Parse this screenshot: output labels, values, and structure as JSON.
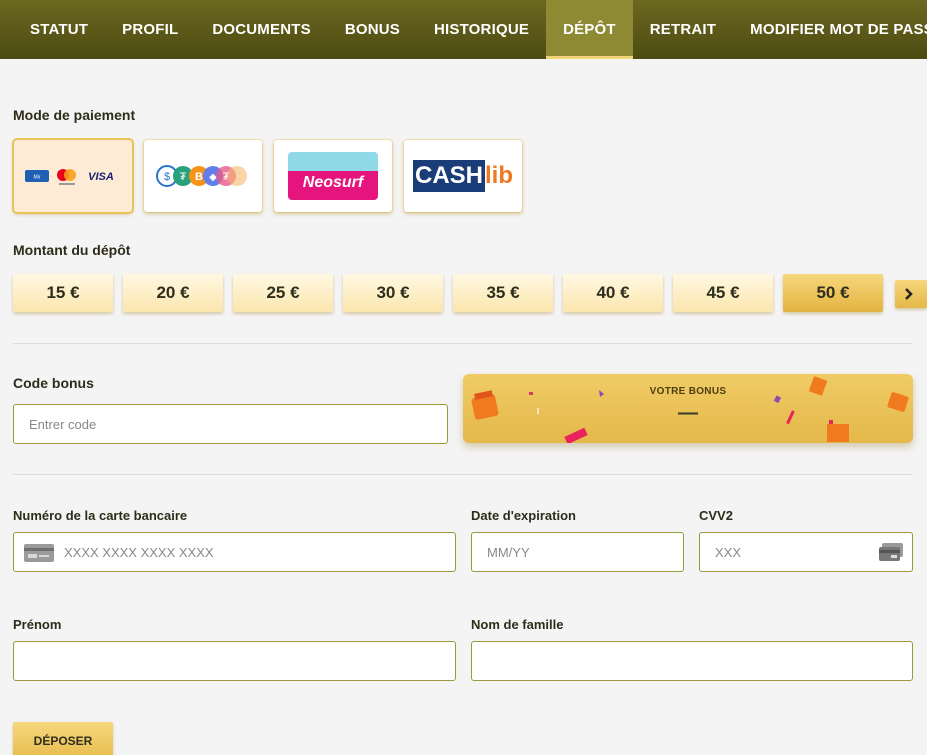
{
  "nav": {
    "items": [
      {
        "label": "STATUT",
        "active": false
      },
      {
        "label": "PROFIL",
        "active": false
      },
      {
        "label": "DOCUMENTS",
        "active": false
      },
      {
        "label": "BONUS",
        "active": false
      },
      {
        "label": "HISTORIQUE",
        "active": false
      },
      {
        "label": "DÉPÔT",
        "active": true
      },
      {
        "label": "RETRAIT",
        "active": false
      },
      {
        "label": "MODIFIER MOT DE PASSE",
        "active": false
      }
    ]
  },
  "payment": {
    "label": "Mode de paiement",
    "methods": [
      {
        "name": "cards",
        "selected": true,
        "logo_text": "VISA"
      },
      {
        "name": "crypto",
        "selected": false
      },
      {
        "name": "neosurf",
        "selected": false,
        "logo_text": "Neosurf"
      },
      {
        "name": "cashlib",
        "selected": false,
        "logo_text_a": "CASH",
        "logo_text_b": "lib"
      }
    ]
  },
  "amount": {
    "label": "Montant du dépôt",
    "options": [
      "15 €",
      "20 €",
      "25 €",
      "30 €",
      "35 €",
      "40 €",
      "45 €",
      "50 €"
    ],
    "selected": "50 €"
  },
  "bonus": {
    "label": "Code bonus",
    "input_placeholder": "Entrer code",
    "card_title": "VOTRE BONUS",
    "card_value": "—"
  },
  "card": {
    "number_label": "Numéro de la carte bancaire",
    "number_placeholder": "XXXX XXXX XXXX XXXX",
    "expiry_label": "Date d'expiration",
    "expiry_placeholder": "MM/YY",
    "cvv_label": "CVV2",
    "cvv_placeholder": "XXX"
  },
  "name": {
    "first_label": "Prénom",
    "last_label": "Nom de famille"
  },
  "submit_label": "DÉPOSER",
  "colors": {
    "nav": "#5c5a18",
    "accent": "#e9c25a",
    "field_border": "#9a9a3c"
  }
}
